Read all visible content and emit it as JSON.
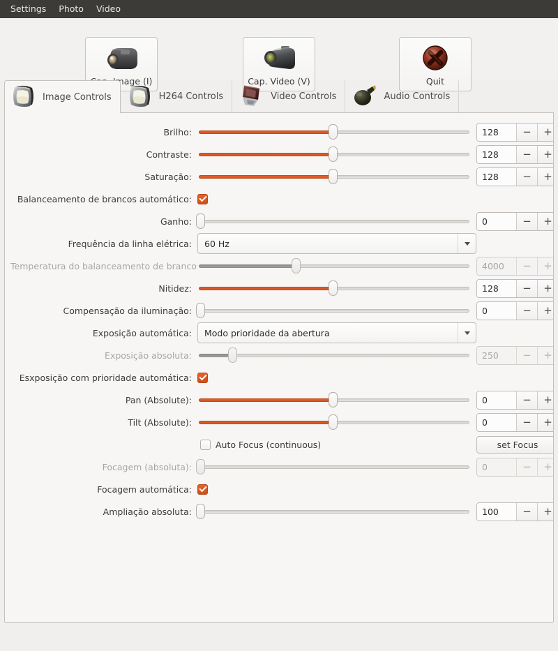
{
  "menubar": {
    "items": [
      {
        "label": "Settings"
      },
      {
        "label": "Photo"
      },
      {
        "label": "Video"
      }
    ]
  },
  "toolbar": {
    "buttons": [
      {
        "label": "Cap. Image (I)",
        "icon": "photo-camera-icon"
      },
      {
        "label": "Cap. Video (V)",
        "icon": "video-camera-icon"
      },
      {
        "label": "Quit",
        "icon": "quit-x-icon"
      }
    ]
  },
  "tabs": [
    {
      "label": "Image Controls",
      "icon": "image-controls-icon",
      "active": true
    },
    {
      "label": "H264 Controls",
      "icon": "h264-controls-icon",
      "active": false
    },
    {
      "label": "Video Controls",
      "icon": "video-controls-icon",
      "active": false
    },
    {
      "label": "Audio Controls",
      "icon": "audio-controls-icon",
      "active": false
    }
  ],
  "colors": {
    "accent": "#e25c22",
    "menubar_bg": "#3c3b37",
    "panel_bg": "#f7f6f5",
    "window_bg": "#f0efee"
  },
  "controls": [
    {
      "name": "brilho",
      "label": "Brilho:",
      "type": "slider-spin",
      "value": "128",
      "percent": 50,
      "disabled": false,
      "minus": "−",
      "plus": "+"
    },
    {
      "name": "contraste",
      "label": "Contraste:",
      "type": "slider-spin",
      "value": "128",
      "percent": 50,
      "disabled": false,
      "minus": "−",
      "plus": "+"
    },
    {
      "name": "saturacao",
      "label": "Saturação:",
      "type": "slider-spin",
      "value": "128",
      "percent": 50,
      "disabled": false,
      "minus": "−",
      "plus": "+"
    },
    {
      "name": "balanceamento-de-brancos-automatico",
      "label": "Balanceamento de brancos automático:",
      "type": "checkbox",
      "checked": true,
      "disabled": false
    },
    {
      "name": "ganho",
      "label": "Ganho:",
      "type": "slider-spin",
      "value": "0",
      "percent": 0,
      "disabled": false,
      "minus": "−",
      "plus": "+"
    },
    {
      "name": "frequencia-da-linha-eletrica",
      "label": "Frequência da linha elétrica:",
      "type": "combo",
      "value": "60 Hz",
      "disabled": false
    },
    {
      "name": "temperatura-do-balanceamento-de-brancos",
      "label": "Temperatura do balanceamento de brancos:",
      "type": "slider-spin",
      "value": "4000",
      "percent": 36,
      "disabled": true,
      "minus": "−",
      "plus": "+"
    },
    {
      "name": "nitidez",
      "label": "Nitidez:",
      "type": "slider-spin",
      "value": "128",
      "percent": 50,
      "disabled": false,
      "minus": "−",
      "plus": "+"
    },
    {
      "name": "compensacao-da-iluminacao",
      "label": "Compensação da iluminação:",
      "type": "slider-spin",
      "value": "0",
      "percent": 0,
      "disabled": false,
      "minus": "−",
      "plus": "+"
    },
    {
      "name": "exposicao-automatica",
      "label": "Exposição automática:",
      "type": "combo",
      "value": "Modo prioridade da abertura",
      "disabled": false
    },
    {
      "name": "exposicao-absoluta",
      "label": "Exposição absoluta:",
      "type": "slider-spin",
      "value": "250",
      "percent": 12,
      "disabled": true,
      "minus": "−",
      "plus": "+"
    },
    {
      "name": "exposicao-com-prioridade-automatica",
      "label": "Esxposição com prioridade automática:",
      "type": "checkbox",
      "checked": true,
      "disabled": false
    },
    {
      "name": "pan-absolute",
      "label": "Pan (Absolute):",
      "type": "slider-spin",
      "value": "0",
      "percent": 50,
      "disabled": false,
      "minus": "−",
      "plus": "+"
    },
    {
      "name": "tilt-absolute",
      "label": "Tilt (Absolute):",
      "type": "slider-spin",
      "value": "0",
      "percent": 50,
      "disabled": false,
      "minus": "−",
      "plus": "+"
    },
    {
      "name": "auto-focus-continuous",
      "label": "",
      "type": "inline-checkbox-button",
      "inline_label": "Auto Focus (continuous)",
      "checked": false,
      "button_label": "set Focus",
      "disabled": false
    },
    {
      "name": "focagem-absoluta",
      "label": "Focagem (absoluta):",
      "type": "slider-spin",
      "value": "0",
      "percent": 0,
      "disabled": true,
      "minus": "−",
      "plus": "+"
    },
    {
      "name": "focagem-automatica",
      "label": "Focagem automática:",
      "type": "checkbox",
      "checked": true,
      "disabled": false
    },
    {
      "name": "ampliacao-absoluta",
      "label": "Ampliação absoluta:",
      "type": "slider-spin",
      "value": "100",
      "percent": 0,
      "disabled": false,
      "minus": "−",
      "plus": "+"
    }
  ]
}
